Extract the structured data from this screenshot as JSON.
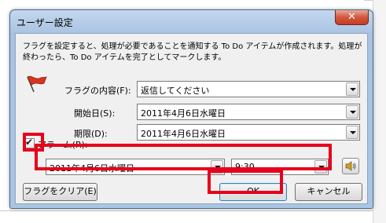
{
  "window": {
    "title": "ユーザー設定",
    "close_symbol": "✕"
  },
  "description": "フラグを設定すると、処理が必要であることを通知する To Do アイテムが作成されます。処理が終わったら、To Do アイテムを完了としてマークします。",
  "flag_to": {
    "label": "フラグの内容(F):",
    "value": "返信してください"
  },
  "start_date": {
    "label": "開始日(S):",
    "value": "2011年4月6日水曜日"
  },
  "due_date": {
    "label": "期限(D):",
    "value": "2011年4月6日水曜日"
  },
  "reminder": {
    "label": "アラーム(R):",
    "checked": true,
    "check_symbol": "✔",
    "date": "2011年4月6日水曜日",
    "time": "9:30"
  },
  "buttons": {
    "clear_flag": "フラグをクリア(E)",
    "ok": "OK",
    "cancel": "キャンセル"
  },
  "colors": {
    "highlight": "#e8001c",
    "title_bar": "#a9c5e4",
    "close_button": "#c73b21"
  },
  "icons": {
    "flag": "red-flag-icon",
    "sound": "speaker-icon",
    "dropdown": "chevron-down-icon"
  }
}
